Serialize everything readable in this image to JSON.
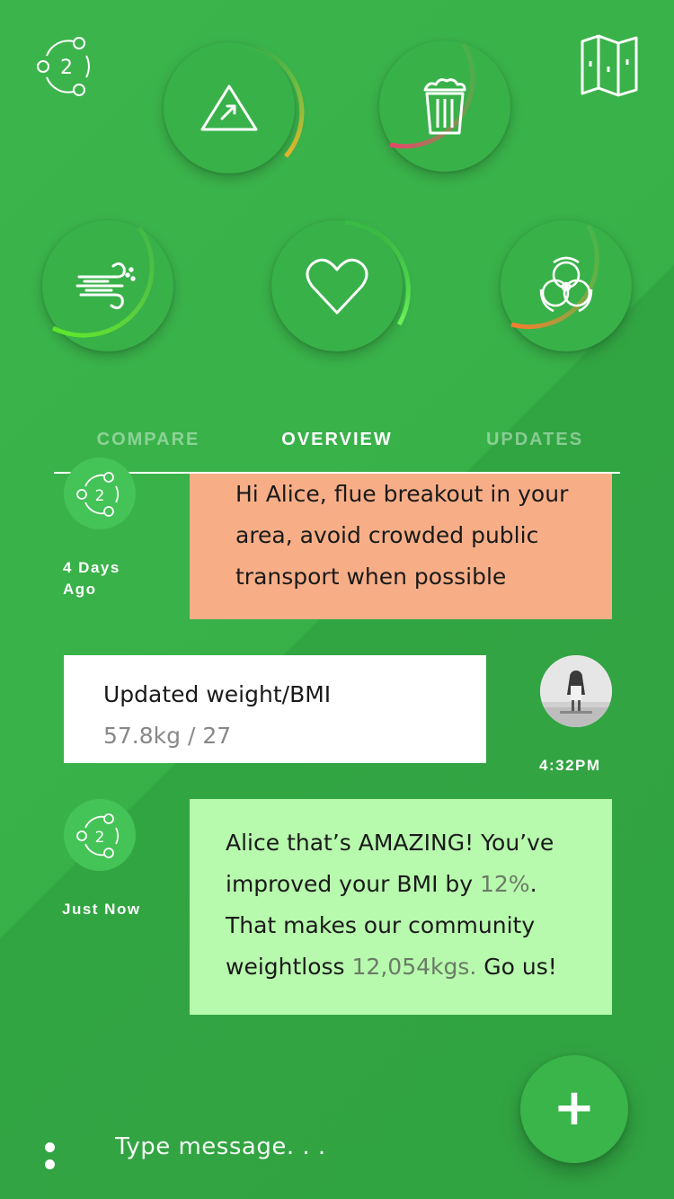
{
  "header": {
    "logo_icon": "community-circle-2-icon",
    "logo_number": "2",
    "map_icon": "map-icon"
  },
  "gauges": [
    {
      "name": "alerts",
      "icon": "warning-triangle-arrow-icon",
      "level": 0.28,
      "colors": [
        "#cbe23a",
        "#e6b12a"
      ]
    },
    {
      "name": "waste",
      "icon": "trash-bin-icon",
      "level": 0.55,
      "colors": [
        "#7fb04a",
        "#e9456a"
      ]
    },
    {
      "name": "air",
      "icon": "wind-icon",
      "level": 0.6,
      "colors": [
        "#8fe83a",
        "#5ee82a"
      ]
    },
    {
      "name": "health",
      "icon": "heart-icon",
      "level": 0.45,
      "colors": [
        "#3bd13a",
        "#6df25a"
      ]
    },
    {
      "name": "biohazard",
      "icon": "biohazard-icon",
      "level": 0.38,
      "colors": [
        "#7fc24a",
        "#ff7a2e"
      ]
    }
  ],
  "tabs": [
    {
      "label": "COMPARE",
      "active": false
    },
    {
      "label": "OVERVIEW",
      "active": true
    },
    {
      "label": "UPDATES",
      "active": false
    }
  ],
  "messages": {
    "m1": {
      "time_line1": "4 Days",
      "time_line2": "Ago",
      "lines": [
        "Hi Alice, flue breakout in your",
        "area, avoid crowded public",
        "transport when possible"
      ],
      "color": "#f7ae87"
    },
    "m2": {
      "title": "Updated weight/BMI",
      "value": "57.8kg / 27",
      "time": "4:32PM",
      "color": "#ffffff"
    },
    "m3": {
      "time": "Just Now",
      "line1": "Alice that’s AMAZING! You’ve",
      "line2_pre": "improved your BMI by ",
      "line2_hl": "12%",
      "line2_post": ".",
      "line3": "That makes our community",
      "line4_pre": "weightloss ",
      "line4_hl": "12,054kgs.",
      "line4_post": " Go us!",
      "color": "#b7f9ad"
    }
  },
  "composer": {
    "placeholder": "Type message. . .",
    "add_symbol": "+"
  },
  "theme": {
    "primary": "#39b54a",
    "tab_inactive": "rgba(255,255,255,0.42)"
  }
}
